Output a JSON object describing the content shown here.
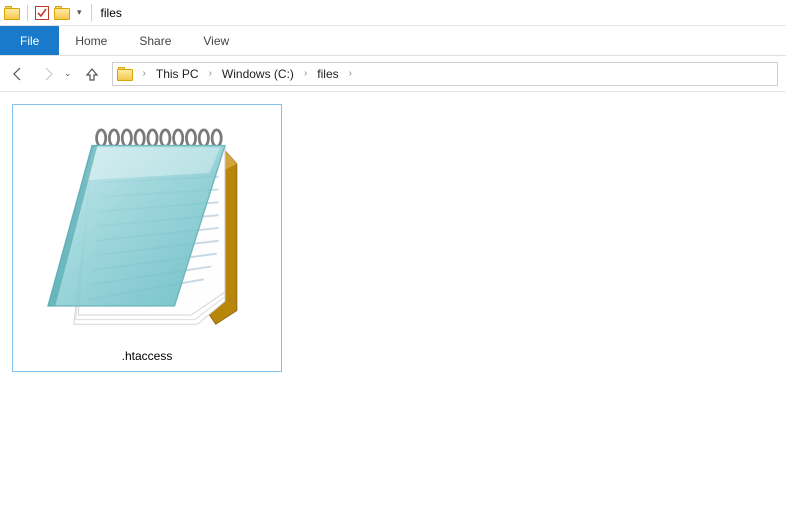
{
  "window": {
    "title": "files"
  },
  "ribbon": {
    "file": "File",
    "tabs": [
      "Home",
      "Share",
      "View"
    ]
  },
  "breadcrumbs": {
    "items": [
      "This PC",
      "Windows (C:)",
      "files"
    ]
  },
  "files": [
    {
      "name": ".htaccess",
      "icon": "notepad"
    }
  ]
}
